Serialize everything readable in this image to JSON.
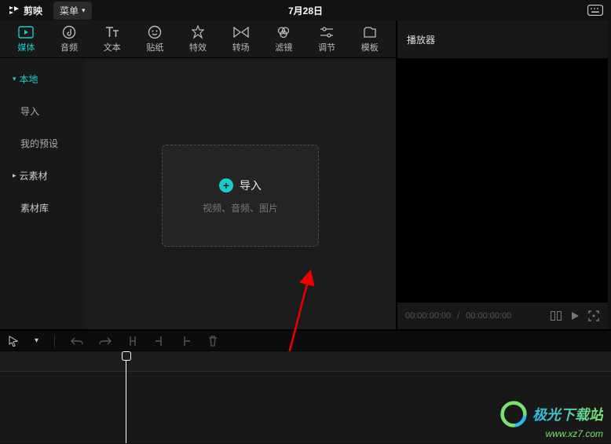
{
  "titlebar": {
    "brand": "剪映",
    "menu_label": "菜单",
    "date": "7月28日"
  },
  "tabs": [
    {
      "label": "媒体"
    },
    {
      "label": "音频"
    },
    {
      "label": "文本"
    },
    {
      "label": "贴纸"
    },
    {
      "label": "特效"
    },
    {
      "label": "转场"
    },
    {
      "label": "滤镜"
    },
    {
      "label": "调节"
    },
    {
      "label": "模板"
    }
  ],
  "sidebar": {
    "local": "本地",
    "import": "导入",
    "presets": "我的预设",
    "cloud": "云素材",
    "library": "素材库"
  },
  "dropbox": {
    "label": "导入",
    "hint": "视频、音频、图片"
  },
  "player": {
    "title": "播放器",
    "current": "00:00:00:00",
    "duration": "00:00:00:00"
  },
  "watermark": {
    "name": "极光下载站",
    "url": "www.xz7.com"
  }
}
